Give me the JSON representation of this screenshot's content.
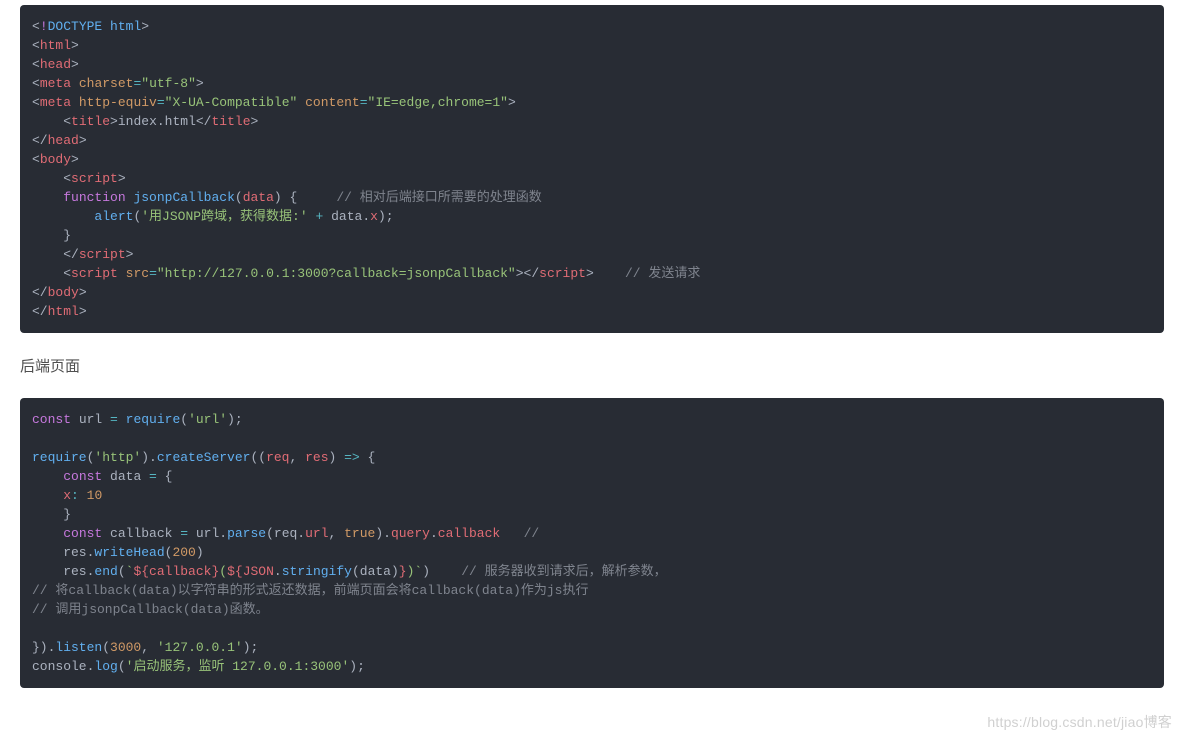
{
  "section_title": "后端页面",
  "watermark": "https://blog.csdn.net/jiao博客",
  "block1": [
    [
      [
        "brack",
        "<"
      ],
      [
        "kw",
        "!"
      ],
      [
        "doctype",
        "DOCTYPE html"
      ],
      [
        "brack",
        ">"
      ]
    ],
    [
      [
        "brack",
        "<"
      ],
      [
        "tag",
        "html"
      ],
      [
        "brack",
        ">"
      ]
    ],
    [
      [
        "brack",
        "<"
      ],
      [
        "tag",
        "head"
      ],
      [
        "brack",
        ">"
      ]
    ],
    [
      [
        "brack",
        "<"
      ],
      [
        "tag",
        "meta"
      ],
      [
        "plain",
        " "
      ],
      [
        "attr",
        "charset"
      ],
      [
        "op",
        "="
      ],
      [
        "str",
        "\"utf-8\""
      ],
      [
        "brack",
        ">"
      ]
    ],
    [
      [
        "brack",
        "<"
      ],
      [
        "tag",
        "meta"
      ],
      [
        "plain",
        " "
      ],
      [
        "attr",
        "http-equiv"
      ],
      [
        "op",
        "="
      ],
      [
        "str",
        "\"X-UA-Compatible\""
      ],
      [
        "plain",
        " "
      ],
      [
        "attr",
        "content"
      ],
      [
        "op",
        "="
      ],
      [
        "str",
        "\"IE=edge,chrome=1\""
      ],
      [
        "brack",
        ">"
      ]
    ],
    [
      [
        "plain",
        "    "
      ],
      [
        "brack",
        "<"
      ],
      [
        "tag",
        "title"
      ],
      [
        "brack",
        ">"
      ],
      [
        "plain",
        "index.html"
      ],
      [
        "brack",
        "</"
      ],
      [
        "tag",
        "title"
      ],
      [
        "brack",
        ">"
      ]
    ],
    [
      [
        "brack",
        "</"
      ],
      [
        "tag",
        "head"
      ],
      [
        "brack",
        ">"
      ]
    ],
    [
      [
        "brack",
        "<"
      ],
      [
        "tag",
        "body"
      ],
      [
        "brack",
        ">"
      ]
    ],
    [
      [
        "plain",
        "    "
      ],
      [
        "brack",
        "<"
      ],
      [
        "tag",
        "script"
      ],
      [
        "brack",
        ">"
      ]
    ],
    [
      [
        "plain",
        "    "
      ],
      [
        "kw",
        "function"
      ],
      [
        "plain",
        " "
      ],
      [
        "fn",
        "jsonpCallback"
      ],
      [
        "plain",
        "("
      ],
      [
        "var",
        "data"
      ],
      [
        "plain",
        ") {     "
      ],
      [
        "comm",
        "// 相对后端接口所需要的处理函数"
      ]
    ],
    [
      [
        "plain",
        "        "
      ],
      [
        "fn",
        "alert"
      ],
      [
        "plain",
        "("
      ],
      [
        "str",
        "'用JSONP跨域，获得数据:'"
      ],
      [
        "plain",
        " "
      ],
      [
        "op",
        "+"
      ],
      [
        "plain",
        " data"
      ],
      [
        "plain",
        "."
      ],
      [
        "prop",
        "x"
      ],
      [
        "plain",
        ");"
      ]
    ],
    [
      [
        "plain",
        "    }"
      ]
    ],
    [
      [
        "plain",
        "    "
      ],
      [
        "brack",
        "</"
      ],
      [
        "tag",
        "script"
      ],
      [
        "brack",
        ">"
      ]
    ],
    [
      [
        "plain",
        "    "
      ],
      [
        "brack",
        "<"
      ],
      [
        "tag",
        "script"
      ],
      [
        "plain",
        " "
      ],
      [
        "attr",
        "src"
      ],
      [
        "op",
        "="
      ],
      [
        "str",
        "\"http://127.0.0.1:3000?callback=jsonpCallback\""
      ],
      [
        "brack",
        ">"
      ],
      [
        "brack",
        "</"
      ],
      [
        "tag",
        "script"
      ],
      [
        "brack",
        ">"
      ],
      [
        "plain",
        "    "
      ],
      [
        "comm",
        "// 发送请求"
      ]
    ],
    [
      [
        "brack",
        "</"
      ],
      [
        "tag",
        "body"
      ],
      [
        "brack",
        ">"
      ]
    ],
    [
      [
        "brack",
        "</"
      ],
      [
        "tag",
        "html"
      ],
      [
        "brack",
        ">"
      ]
    ]
  ],
  "block2": [
    [
      [
        "kw",
        "const"
      ],
      [
        "plain",
        " url "
      ],
      [
        "op",
        "="
      ],
      [
        "plain",
        " "
      ],
      [
        "fn",
        "require"
      ],
      [
        "plain",
        "("
      ],
      [
        "str",
        "'url'"
      ],
      [
        "plain",
        ");"
      ]
    ],
    [],
    [
      [
        "fn",
        "require"
      ],
      [
        "plain",
        "("
      ],
      [
        "str",
        "'http'"
      ],
      [
        "plain",
        ")."
      ],
      [
        "fn",
        "createServer"
      ],
      [
        "plain",
        "(("
      ],
      [
        "var",
        "req"
      ],
      [
        "plain",
        ", "
      ],
      [
        "var",
        "res"
      ],
      [
        "plain",
        ") "
      ],
      [
        "op",
        "=>"
      ],
      [
        "plain",
        " {"
      ]
    ],
    [
      [
        "plain",
        "    "
      ],
      [
        "kw",
        "const"
      ],
      [
        "plain",
        " data "
      ],
      [
        "op",
        "="
      ],
      [
        "plain",
        " {"
      ]
    ],
    [
      [
        "plain",
        "    "
      ],
      [
        "prop",
        "x"
      ],
      [
        "op",
        ":"
      ],
      [
        "plain",
        " "
      ],
      [
        "num",
        "10"
      ]
    ],
    [
      [
        "plain",
        "    }"
      ]
    ],
    [
      [
        "plain",
        "    "
      ],
      [
        "kw",
        "const"
      ],
      [
        "plain",
        " callback "
      ],
      [
        "op",
        "="
      ],
      [
        "plain",
        " url."
      ],
      [
        "fn",
        "parse"
      ],
      [
        "plain",
        "(req."
      ],
      [
        "prop",
        "url"
      ],
      [
        "plain",
        ", "
      ],
      [
        "bool",
        "true"
      ],
      [
        "plain",
        ")."
      ],
      [
        "prop",
        "query"
      ],
      [
        "plain",
        "."
      ],
      [
        "prop",
        "callback"
      ],
      [
        "plain",
        "   "
      ],
      [
        "comm",
        "// "
      ]
    ],
    [
      [
        "plain",
        "    res."
      ],
      [
        "fn",
        "writeHead"
      ],
      [
        "plain",
        "("
      ],
      [
        "num",
        "200"
      ],
      [
        "plain",
        ")"
      ]
    ],
    [
      [
        "plain",
        "    res."
      ],
      [
        "fn",
        "end"
      ],
      [
        "plain",
        "("
      ],
      [
        "tstr",
        "`"
      ],
      [
        "tinterp",
        "${callback}"
      ],
      [
        "tstr",
        "("
      ],
      [
        "tinterp",
        "${"
      ],
      [
        "var",
        "JSON"
      ],
      [
        "plain",
        "."
      ],
      [
        "fn",
        "stringify"
      ],
      [
        "plain",
        "("
      ],
      [
        "plain",
        "data"
      ],
      [
        "plain",
        ")"
      ],
      [
        "tinterp",
        "}"
      ],
      [
        "tstr",
        ")`"
      ],
      [
        "plain",
        ")    "
      ],
      [
        "comm",
        "// 服务器收到请求后，解析参数，"
      ]
    ],
    [
      [
        "comm",
        "// 将callback(data)以字符串的形式返还数据，前端页面会将callback(data)作为js执行"
      ]
    ],
    [
      [
        "comm",
        "// 调用jsonpCallback(data)函数。"
      ]
    ],
    [],
    [
      [
        "plain",
        "})."
      ],
      [
        "fn",
        "listen"
      ],
      [
        "plain",
        "("
      ],
      [
        "num",
        "3000"
      ],
      [
        "plain",
        ", "
      ],
      [
        "str",
        "'127.0.0.1'"
      ],
      [
        "plain",
        ");"
      ]
    ],
    [
      [
        "plain",
        "console."
      ],
      [
        "fn",
        "log"
      ],
      [
        "plain",
        "("
      ],
      [
        "str",
        "'启动服务，监听 127.0.0.1:3000'"
      ],
      [
        "plain",
        ");"
      ]
    ]
  ]
}
